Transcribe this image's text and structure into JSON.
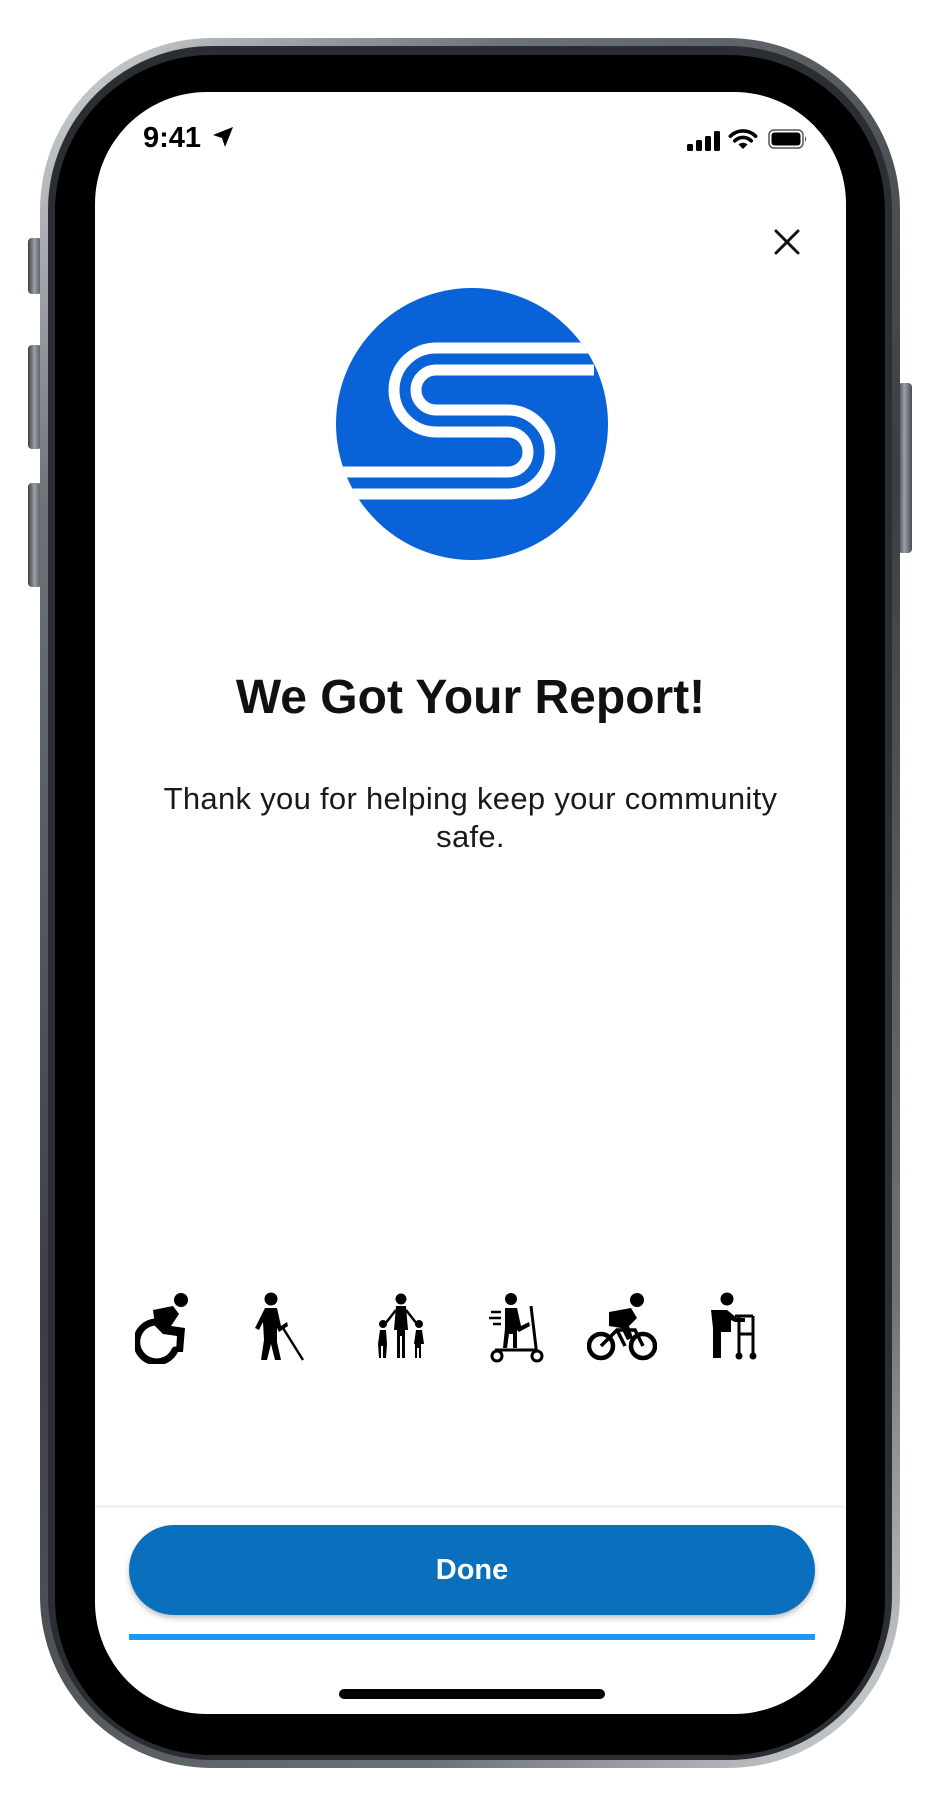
{
  "status_bar": {
    "time": "9:41"
  },
  "modal": {
    "close_icon": "close-icon",
    "logo_icon": "s-logo-icon",
    "title": "We Got Your Report!",
    "message": "Thank you for helping keep your community safe."
  },
  "mobility_icons": [
    "wheelchair-icon",
    "blind-pedestrian-icon",
    "family-icon",
    "scooter-icon",
    "cyclist-icon",
    "walker-icon"
  ],
  "footer": {
    "done_label": "Done",
    "progress_fraction": 1.0
  },
  "colors": {
    "brand_blue": "#0a62d8",
    "button_blue": "#0a70bd",
    "progress_blue": "#2196f3"
  }
}
